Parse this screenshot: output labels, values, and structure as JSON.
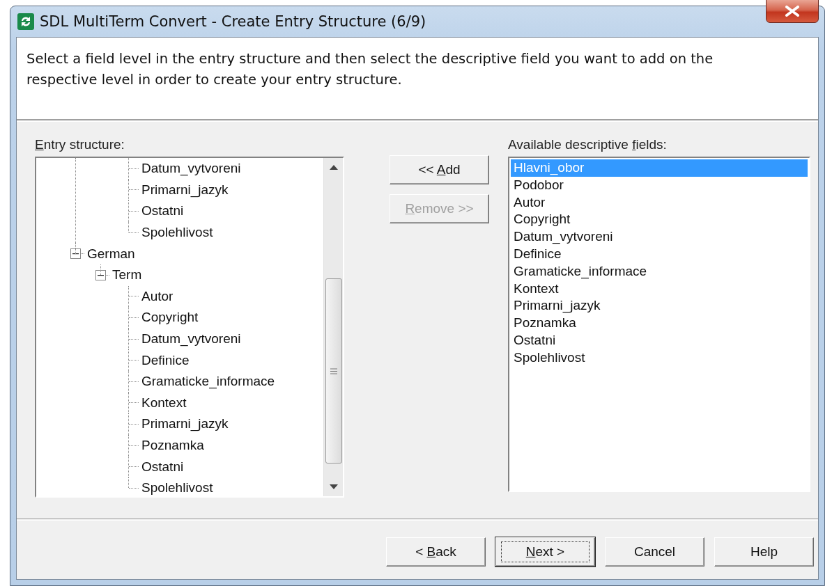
{
  "window": {
    "title": "SDL MultiTerm Convert - Create Entry Structure (6/9)"
  },
  "instruction": "Select a field level in the entry structure and then select the descriptive field you want to add on the respective level in order to create your entry structure.",
  "entry_structure": {
    "label": {
      "key": "E",
      "after": "ntry structure:"
    },
    "tree": [
      {
        "kind": "clipped",
        "children": [
          {
            "kind": "clipped",
            "children": [
              {
                "kind": "leaf",
                "label": "Datum_vytvoreni"
              },
              {
                "kind": "leaf",
                "label": "Primarni_jazyk"
              },
              {
                "kind": "leaf",
                "label": "Ostatni"
              },
              {
                "kind": "leaf",
                "label": "Spolehlivost"
              }
            ]
          }
        ]
      },
      {
        "kind": "node",
        "label": "German",
        "expanded": true,
        "children": [
          {
            "kind": "node",
            "label": "Term",
            "expanded": true,
            "children": [
              {
                "kind": "leaf",
                "label": "Autor"
              },
              {
                "kind": "leaf",
                "label": "Copyright"
              },
              {
                "kind": "leaf",
                "label": "Datum_vytvoreni"
              },
              {
                "kind": "leaf",
                "label": "Definice"
              },
              {
                "kind": "leaf",
                "label": "Gramaticke_informace"
              },
              {
                "kind": "leaf",
                "label": "Kontext"
              },
              {
                "kind": "leaf",
                "label": "Primarni_jazyk"
              },
              {
                "kind": "leaf",
                "label": "Poznamka"
              },
              {
                "kind": "leaf",
                "label": "Ostatni"
              },
              {
                "kind": "leaf",
                "label": "Spolehlivost"
              }
            ]
          }
        ]
      }
    ]
  },
  "actions": [
    {
      "label": {
        "before": "<< ",
        "key": "A",
        "after": "dd"
      },
      "disabled": false
    },
    {
      "label": {
        "key": "R",
        "after": "emove >>"
      },
      "disabled": true
    }
  ],
  "available_fields": {
    "label": {
      "before": "Available descriptive ",
      "key": "f",
      "after": "ields:"
    },
    "items": [
      {
        "label": "Hlavni_obor",
        "selected": true
      },
      {
        "label": "Podobor",
        "selected": false
      },
      {
        "label": "Autor",
        "selected": false
      },
      {
        "label": "Copyright",
        "selected": false
      },
      {
        "label": "Datum_vytvoreni",
        "selected": false
      },
      {
        "label": "Definice",
        "selected": false
      },
      {
        "label": "Gramaticke_informace",
        "selected": false
      },
      {
        "label": "Kontext",
        "selected": false
      },
      {
        "label": "Primarni_jazyk",
        "selected": false
      },
      {
        "label": "Poznamka",
        "selected": false
      },
      {
        "label": "Ostatni",
        "selected": false
      },
      {
        "label": "Spolehlivost",
        "selected": false
      }
    ]
  },
  "buttons": [
    {
      "label": {
        "before": "< ",
        "key": "B",
        "after": "ack"
      },
      "default": false
    },
    {
      "label": {
        "key": "N",
        "after": "ext >"
      },
      "default": true
    },
    {
      "label": "Cancel",
      "default": false
    },
    {
      "label": "Help",
      "default": false
    }
  ]
}
